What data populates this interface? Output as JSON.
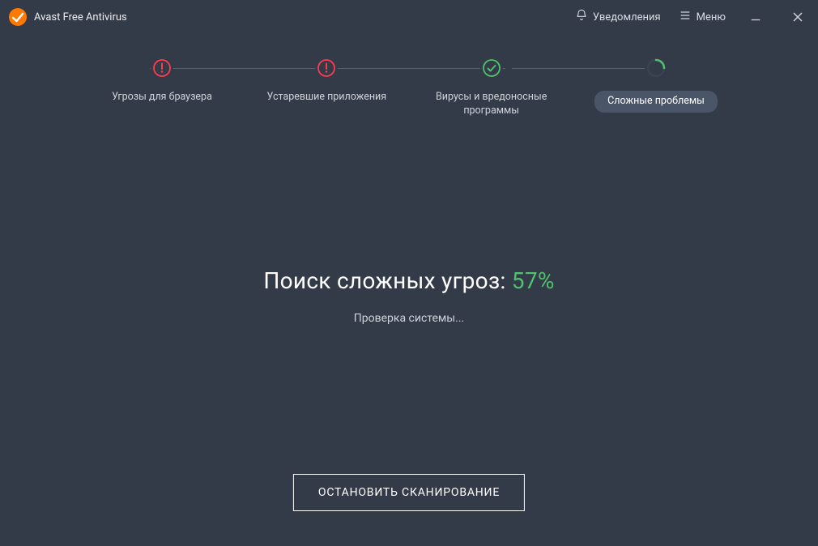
{
  "app": {
    "title": "Avast Free Antivirus"
  },
  "header": {
    "notifications_label": "Уведомления",
    "menu_label": "Меню"
  },
  "steps": [
    {
      "label": "Угрозы для браузера",
      "state": "warn"
    },
    {
      "label": "Устаревшие приложения",
      "state": "warn"
    },
    {
      "label": "Вирусы и вредоносные программы",
      "state": "ok"
    },
    {
      "label": "Сложные проблемы",
      "state": "busy"
    }
  ],
  "scan": {
    "headline_prefix": "Поиск сложных угроз: ",
    "percent_text": "57%",
    "status": "Проверка системы..."
  },
  "actions": {
    "stop_label": "ОСТАНОВИТЬ СКАНИРОВАНИЕ"
  },
  "colors": {
    "accent_green": "#4fc36b",
    "warn_red": "#ff3b4e",
    "bg": "#333a48"
  }
}
